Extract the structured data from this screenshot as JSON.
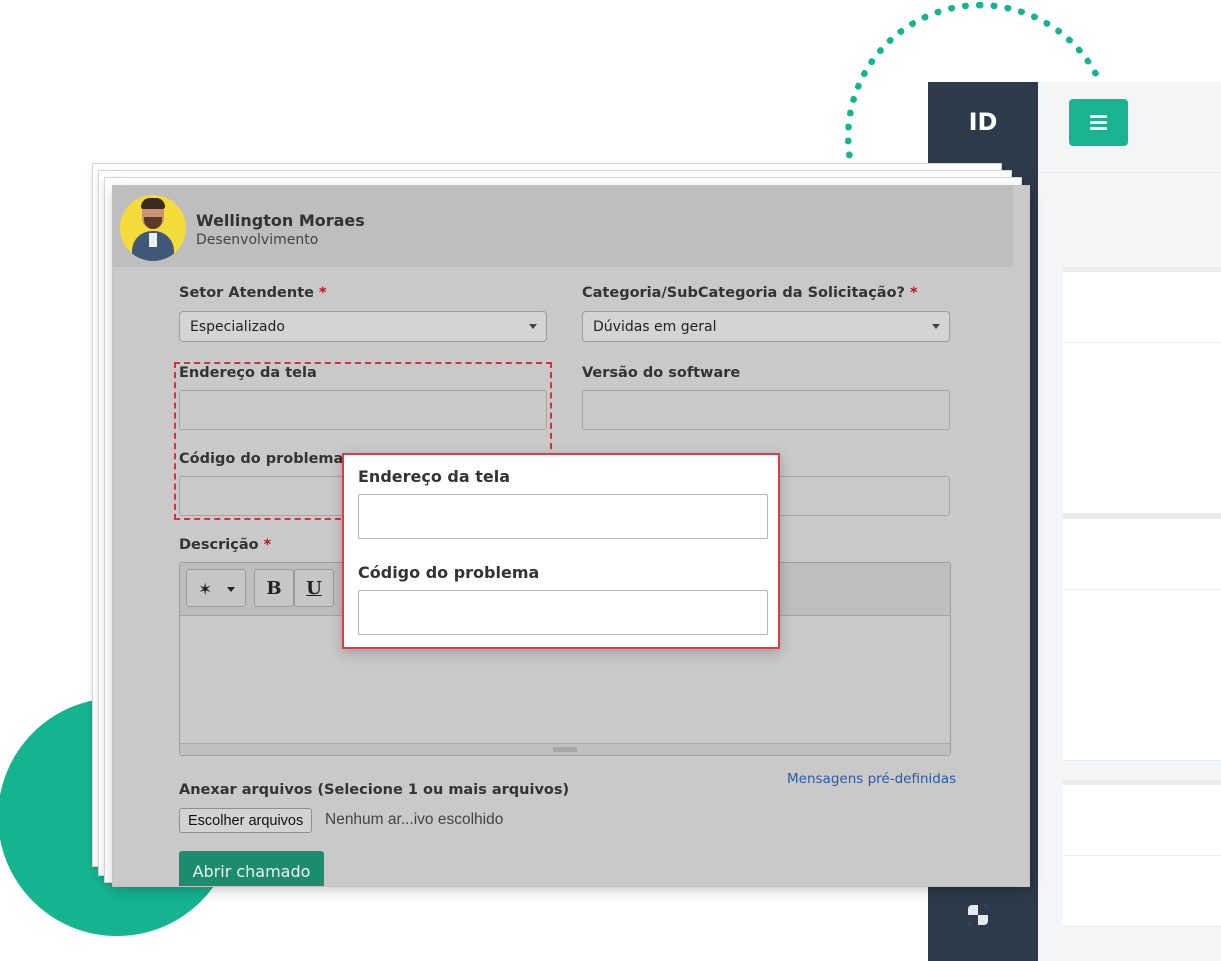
{
  "app": {
    "logo": "ID"
  },
  "user": {
    "name": "Wellington Moraes",
    "department": "Desenvolvimento"
  },
  "form": {
    "setor_label": "Setor Atendente",
    "setor_value": "Especializado",
    "categoria_label": "Categoria/SubCategoria da Solicitação?",
    "categoria_value": "Dúvidas em geral",
    "required_mark": "*",
    "endereco_label": "Endereço da tela",
    "versao_label": "Versão do software",
    "codigo_label": "Código do problema",
    "descricao_label": "Descrição",
    "toolbar": {
      "bold": "B",
      "underline": "U"
    },
    "attach_label": "Anexar arquivos (Selecione 1 ou mais arquivos)",
    "file_button": "Escolher arquivos",
    "file_status": "Nenhum ar...ivo escolhido",
    "predefined_link": "Mensagens pré-definidas",
    "submit_label": "Abrir chamado"
  },
  "popup": {
    "endereco_label": "Endereço da tela",
    "codigo_label": "Código do problema"
  },
  "colors": {
    "accent_green": "#13b48f",
    "sidebar_dark": "#2c3a4a",
    "highlight_red": "#e0394a",
    "submit_green": "#1c8c6e"
  }
}
